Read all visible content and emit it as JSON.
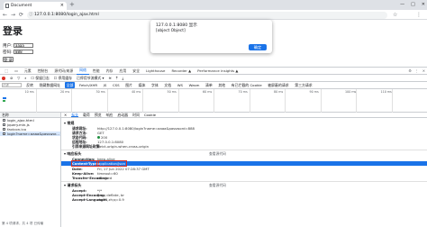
{
  "browser": {
    "tab_title": "Document",
    "new_tab": "+",
    "window_controls": [
      "—",
      "□",
      "✕"
    ],
    "nav_icons": [
      "←",
      "→",
      "⟳"
    ],
    "security_label": "ⓘ",
    "url": "127.0.0.1:8080/login_ajax.html",
    "right_icons": [
      "☆",
      "⋮"
    ]
  },
  "page": {
    "title": "登录",
    "username_label": "用户:",
    "username_value": "aaaa",
    "password_label": "密码:",
    "password_value": "888",
    "login_button": "登 录"
  },
  "alert": {
    "origin": "127.0.0.1:8080 显示",
    "message": "[object Object]",
    "ok_label": "确定"
  },
  "devtools": {
    "tabs": [
      "元素",
      "控制台",
      "源代码/来源",
      "网络",
      "性能",
      "内存",
      "应用",
      "安全",
      "Lighthouse",
      "Recorder ▲",
      "Performance insights ▲"
    ],
    "active_tab": "网络",
    "toolbar": [
      "保留日志",
      "停用缓存",
      "已停用节流模式 ▾"
    ],
    "filter_placeholder": "过滤",
    "filter_opts": [
      "反转",
      "隐藏数据网址",
      "全部",
      "Fetch/XHR",
      "JS",
      "CSS",
      "图片",
      "媒体",
      "字体",
      "文档",
      "WS",
      "Wasm",
      "清单",
      "其他",
      "有已拦截的 Cookie",
      "被屏蔽的请求",
      "第三方请求"
    ],
    "active_filter": "全部",
    "ticks": [
      "10 ms",
      "20 ms",
      "30 ms",
      "40 ms",
      "50 ms",
      "60 ms",
      "70 ms",
      "80 ms",
      "90 ms",
      "100 ms",
      "110 ms"
    ],
    "list_header": "名称",
    "requests": [
      "login_ajax.html",
      "jquery.min.js",
      "favicon.ico",
      "login?name=aaaa&passwor..."
    ],
    "selected_index": 3,
    "list_footer": "第 4 项请求，共 4 项   已传输",
    "detail_tabs": [
      "标头",
      "载荷",
      "预览",
      "响应",
      "启动器",
      "时间",
      "Cookie"
    ],
    "general_title": "▾ 常规",
    "general": [
      {
        "k": "请求网址:",
        "v": "http://127.0.0.1:8080/login?name=aaaa&password=888"
      },
      {
        "k": "请求方法:",
        "v": "GET"
      },
      {
        "k": "状态代码:",
        "v": "200"
      },
      {
        "k": "远程地址:",
        "v": "127.0.0.1:8080"
      },
      {
        "k": "引荐来源网址政策:",
        "v": "strict-origin-when-cross-origin"
      }
    ],
    "response_title": "▾ 响应标头",
    "raw_label": "查看源代码",
    "response": [
      {
        "k": "Connection:",
        "v": "keep-alive"
      },
      {
        "k": "Content-Type:",
        "v": "application/json"
      },
      {
        "k": "Date:",
        "v": "Fri, 17 Jun 2022 07:28:37 GMT"
      },
      {
        "k": "Keep-Alive:",
        "v": "timeout=60"
      },
      {
        "k": "Transfer-Encoding:",
        "v": "chunked"
      }
    ],
    "request_title": "▾ 请求标头",
    "request": [
      {
        "k": "Accept:",
        "v": "*/*"
      },
      {
        "k": "Accept-Encoding:",
        "v": "gzip, deflate, br"
      },
      {
        "k": "Accept-Language:",
        "v": "zh-CN,zh;q=0.9"
      }
    ]
  },
  "colors": {
    "accent": "#1a73e8",
    "highlight_border": "#d93025",
    "status_green": "#1e8e3e"
  }
}
